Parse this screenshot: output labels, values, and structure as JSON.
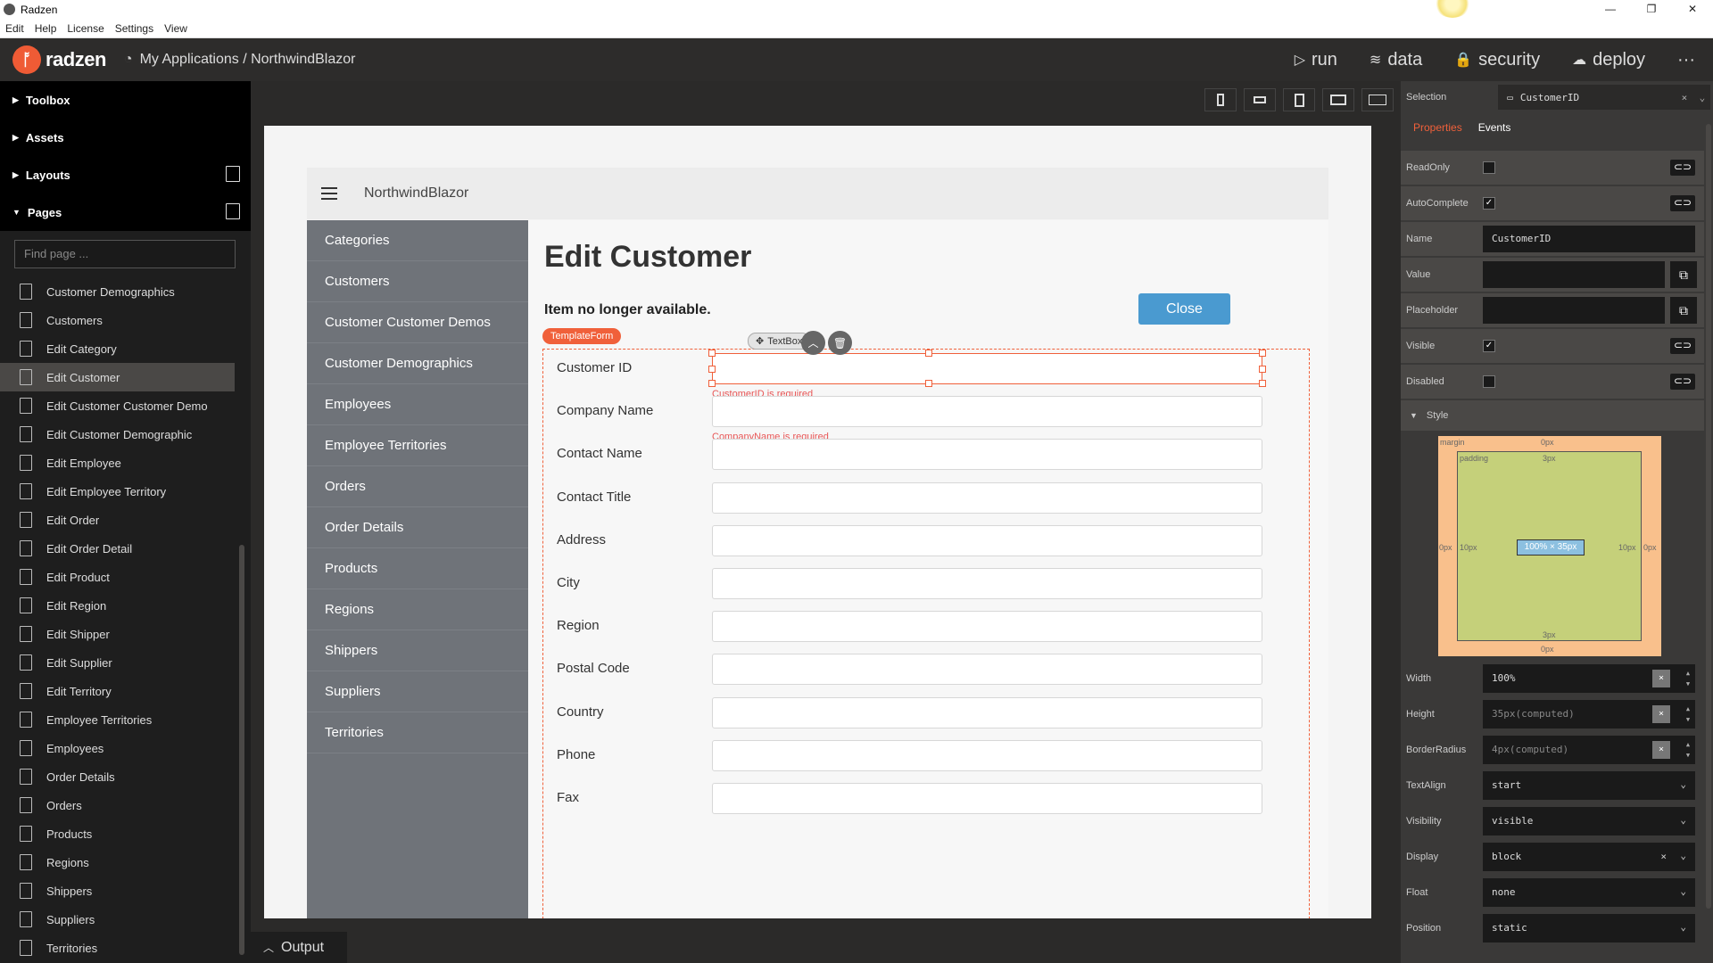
{
  "window": {
    "title": "Radzen",
    "minimize": "—",
    "maximize": "❐",
    "close": "✕"
  },
  "menu": [
    "Edit",
    "Help",
    "License",
    "Settings",
    "View"
  ],
  "header": {
    "logo_text": "radzen",
    "breadcrumb": "My Applications / NorthwindBlazor",
    "nav": [
      {
        "icon": "▷",
        "label": "run"
      },
      {
        "icon": "≋",
        "label": "data"
      },
      {
        "icon": "🔒",
        "label": "security"
      },
      {
        "icon": "☁",
        "label": "deploy"
      }
    ],
    "more": "···"
  },
  "sidebar": {
    "sections": [
      "Toolbox",
      "Assets",
      "Layouts",
      "Pages"
    ],
    "find_placeholder": "Find page ...",
    "pages": [
      "Customer Demographics",
      "Customers",
      "Edit Category",
      "Edit Customer",
      "Edit Customer Customer Demo",
      "Edit Customer Demographic",
      "Edit Employee",
      "Edit Employee Territory",
      "Edit Order",
      "Edit Order Detail",
      "Edit Product",
      "Edit Region",
      "Edit Shipper",
      "Edit Supplier",
      "Edit Territory",
      "Employee Territories",
      "Employees",
      "Order Details",
      "Orders",
      "Products",
      "Regions",
      "Shippers",
      "Suppliers",
      "Territories"
    ],
    "active_page": "Edit Customer"
  },
  "design": {
    "app_title": "NorthwindBlazor",
    "nav_links": [
      "Categories",
      "Customers",
      "Customer Customer Demos",
      "Customer Demographics",
      "Employees",
      "Employee Territories",
      "Orders",
      "Order Details",
      "Products",
      "Regions",
      "Shippers",
      "Suppliers",
      "Territories"
    ],
    "page_title": "Edit Customer",
    "alert": "Item no longer available.",
    "close_button": "Close",
    "template_badge": "TemplateForm",
    "textbox_badge": "TextBox",
    "fields": [
      {
        "label": "Customer ID",
        "error": "CustomerID is required"
      },
      {
        "label": "Company Name",
        "error": "CompanyName is required"
      },
      {
        "label": "Contact Name",
        "error": ""
      },
      {
        "label": "Contact Title",
        "error": ""
      },
      {
        "label": "Address",
        "error": ""
      },
      {
        "label": "City",
        "error": ""
      },
      {
        "label": "Region",
        "error": ""
      },
      {
        "label": "Postal Code",
        "error": ""
      },
      {
        "label": "Country",
        "error": ""
      },
      {
        "label": "Phone",
        "error": ""
      },
      {
        "label": "Fax",
        "error": ""
      }
    ]
  },
  "output": {
    "label": "Output"
  },
  "properties": {
    "selection_label": "Selection",
    "selection_value": "CustomerID",
    "tabs": [
      "Properties",
      "Events"
    ],
    "rows": {
      "readonly": "ReadOnly",
      "autocomplete": "AutoComplete",
      "name": "Name",
      "name_value": "CustomerID",
      "value": "Value",
      "placeholder": "Placeholder",
      "visible": "Visible",
      "disabled": "Disabled"
    },
    "style_label": "Style",
    "boxmodel": {
      "margin": "margin",
      "margin_top": "0px",
      "margin_bottom": "0px",
      "margin_left": "0px",
      "margin_right": "0px",
      "padding": "padding",
      "padding_top": "3px",
      "padding_bottom": "3px",
      "padding_left": "10px",
      "padding_right": "10px",
      "content": "100% × 35px"
    },
    "style_rows": [
      {
        "label": "Width",
        "value": "100%"
      },
      {
        "label": "Height",
        "value": "35px(computed)"
      },
      {
        "label": "BorderRadius",
        "value": "4px(computed)"
      },
      {
        "label": "TextAlign",
        "value": "start"
      },
      {
        "label": "Visibility",
        "value": "visible"
      },
      {
        "label": "Display",
        "value": "block"
      },
      {
        "label": "Float",
        "value": "none"
      },
      {
        "label": "Position",
        "value": "static"
      }
    ]
  }
}
